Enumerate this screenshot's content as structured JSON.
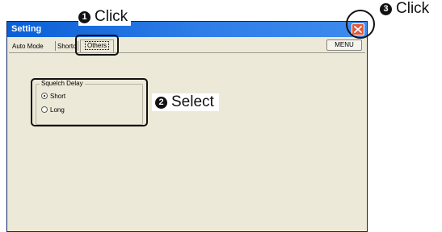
{
  "window": {
    "title": "Setting",
    "tabs": [
      {
        "label": "Auto Mode"
      },
      {
        "label": "Shortc"
      },
      {
        "label": "Others"
      }
    ],
    "menu_button": "MENU"
  },
  "group": {
    "title": "Squelch Delay",
    "options": [
      {
        "label": "Short",
        "selected": true
      },
      {
        "label": "Long",
        "selected": false
      }
    ]
  },
  "annotations": {
    "step1": {
      "number": "1",
      "text": "Click"
    },
    "step2": {
      "number": "2",
      "text": "Select"
    },
    "step3": {
      "number": "3",
      "text": "Click"
    }
  },
  "colors": {
    "titlebar": "#0a5fd6",
    "window_bg": "#ece9d8",
    "close_button": "#e1583c"
  },
  "icons": {
    "close": "close-icon"
  }
}
